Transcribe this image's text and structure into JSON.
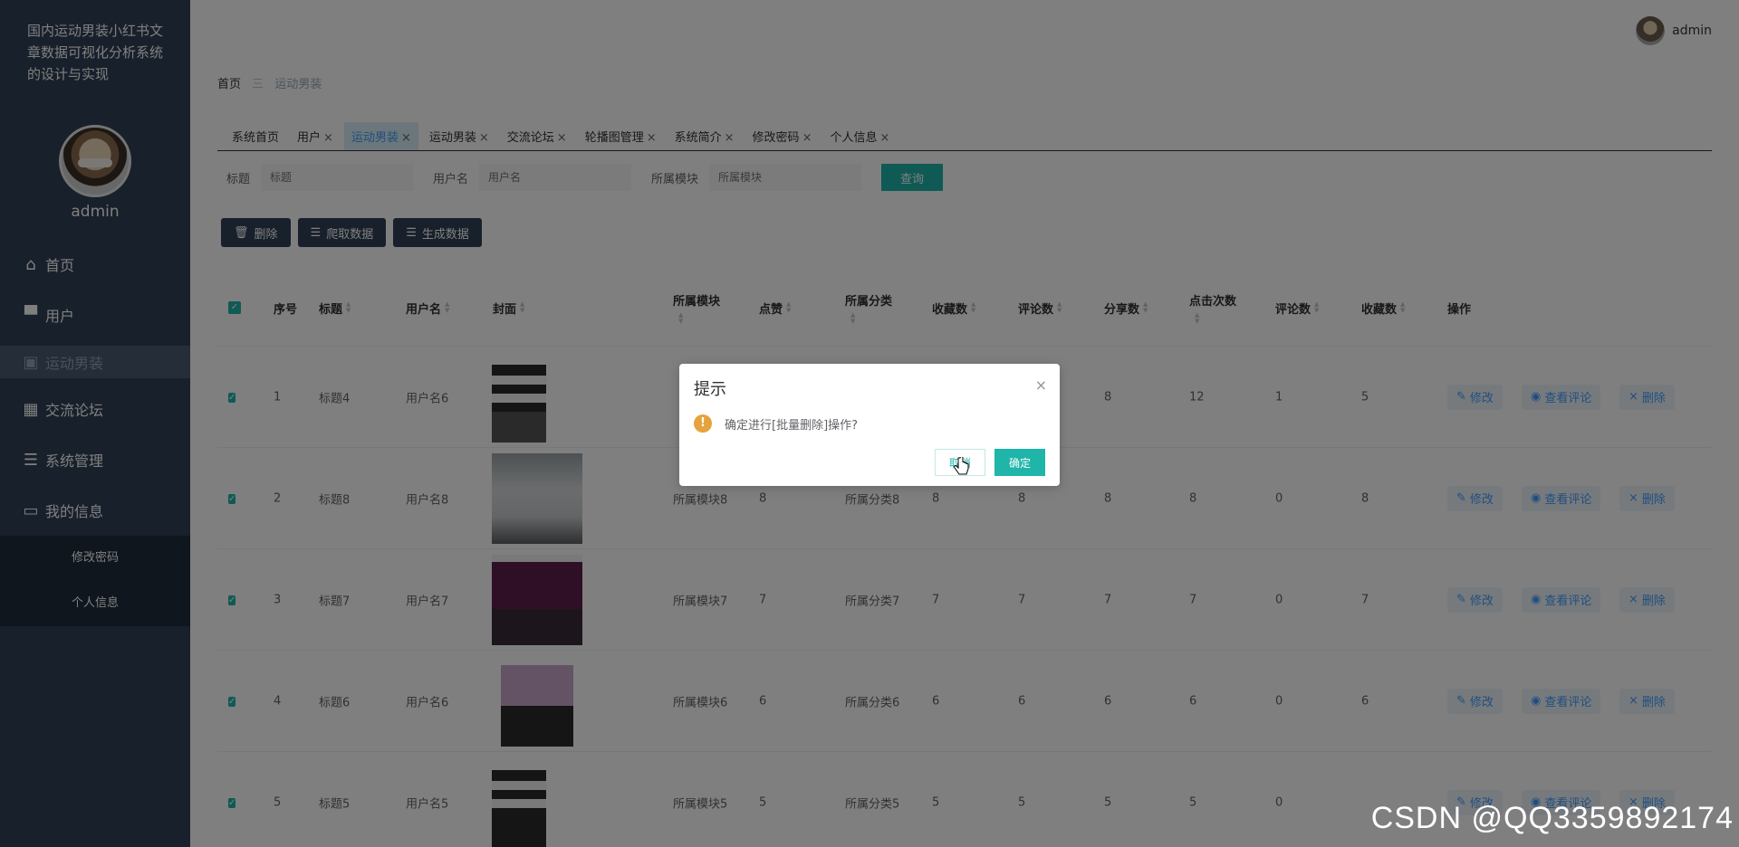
{
  "sidebar": {
    "system_title": "国内运动男装小红书文章数据可视化分析系统的设计与实现",
    "username": "admin",
    "menu": [
      {
        "label": "首页",
        "icon": "home-icon"
      },
      {
        "label": "用户",
        "icon": "user-icon"
      },
      {
        "label": "运动男装",
        "icon": "chart-icon"
      },
      {
        "label": "交流论坛",
        "icon": "grid-icon"
      },
      {
        "label": "系统管理",
        "icon": "sliders-icon"
      },
      {
        "label": "我的信息",
        "icon": "card-icon"
      }
    ],
    "submenu": [
      "修改密码",
      "个人信息"
    ]
  },
  "header": {
    "username": "admin"
  },
  "breadcrumb": {
    "home": "首页",
    "sep": "三",
    "current": "运动男装"
  },
  "tabs": [
    {
      "label": "系统首页",
      "close": ""
    },
    {
      "label": "用户",
      "close": "×"
    },
    {
      "label": "运动男装",
      "close": "×"
    },
    {
      "label": "运动男装",
      "close": "×"
    },
    {
      "label": "交流论坛",
      "close": "×"
    },
    {
      "label": "轮播图管理",
      "close": "×"
    },
    {
      "label": "系统简介",
      "close": "×"
    },
    {
      "label": "修改密码",
      "close": "×"
    },
    {
      "label": "个人信息",
      "close": "×"
    }
  ],
  "search": {
    "title_label": "标题",
    "title_placeholder": "标题",
    "user_label": "用户名",
    "user_placeholder": "用户名",
    "module_label": "所属模块",
    "module_placeholder": "所属模块",
    "button": "查询"
  },
  "actions": {
    "delete": "删除",
    "crawl": "爬取数据",
    "generate": "生成数据"
  },
  "table": {
    "headers": {
      "index": "序号",
      "title": "标题",
      "username": "用户名",
      "cover": "封面",
      "module": "所属模块",
      "likes": "点赞",
      "category": "所属分类",
      "favorites": "收藏数",
      "comments": "评论数",
      "shares": "分享数",
      "clicks": "点击次数",
      "comment_count": "评论数",
      "fav_count": "收藏数",
      "ops": "操作"
    },
    "ops": {
      "edit": "修改",
      "view": "查看评论",
      "del": "删除"
    },
    "rows": [
      {
        "index": "1",
        "title": "标题4",
        "user": "用户名6",
        "module": "",
        "likes": "",
        "category": "",
        "fav": "",
        "cmt": "",
        "share": "8",
        "clicks": "12",
        "cmt2": "1",
        "fav2": "5"
      },
      {
        "index": "2",
        "title": "标题8",
        "user": "用户名8",
        "module": "所属模块8",
        "likes": "8",
        "category": "所属分类8",
        "fav": "8",
        "cmt": "8",
        "share": "8",
        "clicks": "8",
        "cmt2": "0",
        "fav2": "8"
      },
      {
        "index": "3",
        "title": "标题7",
        "user": "用户名7",
        "module": "所属模块7",
        "likes": "7",
        "category": "所属分类7",
        "fav": "7",
        "cmt": "7",
        "share": "7",
        "clicks": "7",
        "cmt2": "0",
        "fav2": "7"
      },
      {
        "index": "4",
        "title": "标题6",
        "user": "用户名6",
        "module": "所属模块6",
        "likes": "6",
        "category": "所属分类6",
        "fav": "6",
        "cmt": "6",
        "share": "6",
        "clicks": "6",
        "cmt2": "0",
        "fav2": "6"
      },
      {
        "index": "5",
        "title": "标题5",
        "user": "用户名5",
        "module": "所属模块5",
        "likes": "5",
        "category": "所属分类5",
        "fav": "5",
        "cmt": "5",
        "share": "5",
        "clicks": "5",
        "cmt2": "0",
        "fav2": ""
      }
    ]
  },
  "dialog": {
    "title": "提示",
    "close": "×",
    "message": "确定进行[批量删除]操作?",
    "cancel": "取消",
    "confirm": "确定"
  },
  "watermark": "CSDN @QQ3359892174",
  "colors": {
    "sidebar": "#304156",
    "accent": "#1fb5a9",
    "warning": "#e6a23c"
  }
}
